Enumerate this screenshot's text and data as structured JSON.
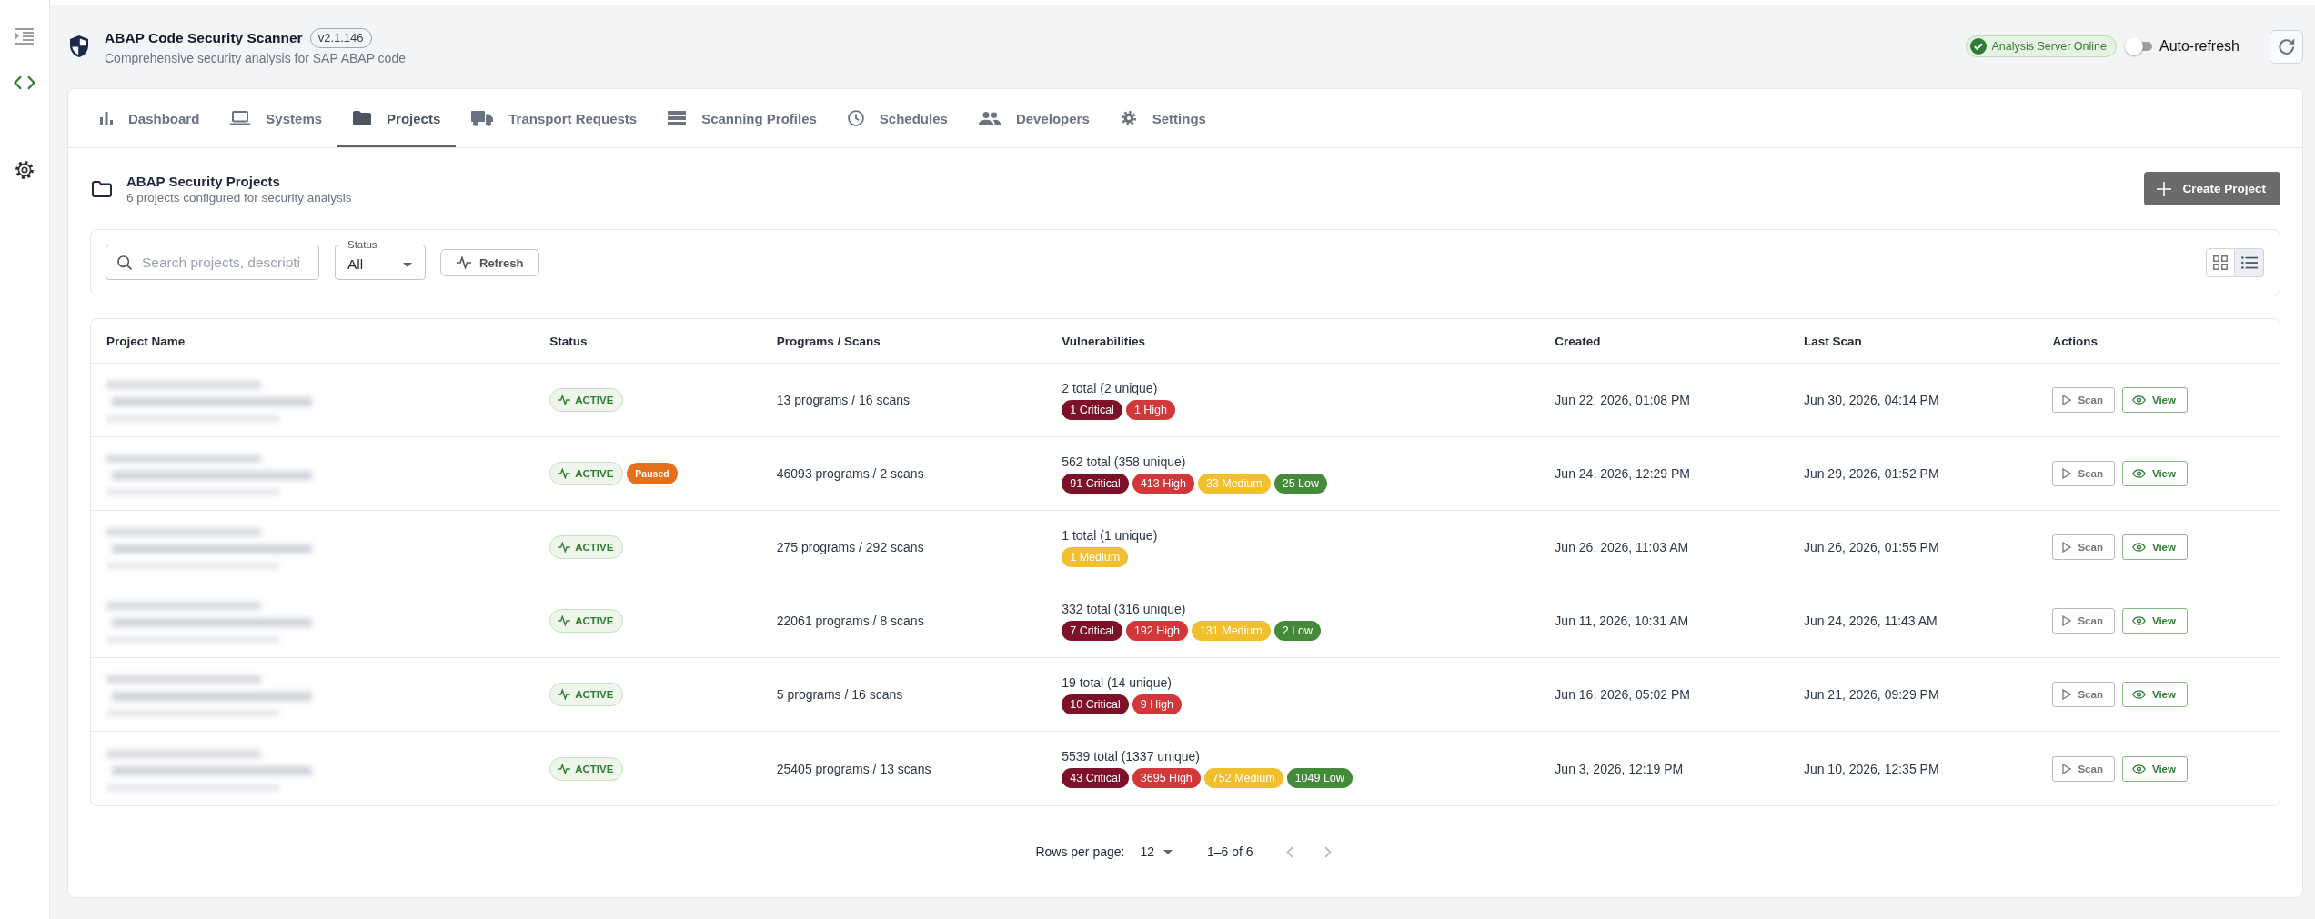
{
  "sidebar": {
    "items": [
      {
        "kind": "code",
        "selected": true
      },
      {
        "kind": "settings",
        "selected": false
      }
    ]
  },
  "header": {
    "title": "ABAP Code Security Scanner",
    "version": "v2.1.146",
    "subtitle": "Comprehensive security analysis for SAP ABAP code",
    "server_status": {
      "label": "Analysis Server Online",
      "online": true
    },
    "auto_refresh": {
      "label": "Auto-refresh",
      "on": false
    }
  },
  "tabs": [
    {
      "label": "Dashboard",
      "kind": "dashboard",
      "selected": false
    },
    {
      "label": "Systems",
      "kind": "systems",
      "selected": false
    },
    {
      "label": "Projects",
      "kind": "projects",
      "selected": true
    },
    {
      "label": "Transport Requests",
      "kind": "transport",
      "selected": false
    },
    {
      "label": "Scanning Profiles",
      "kind": "profiles",
      "selected": false
    },
    {
      "label": "Schedules",
      "kind": "schedules",
      "selected": false
    },
    {
      "label": "Developers",
      "kind": "developers",
      "selected": false
    },
    {
      "label": "Settings",
      "kind": "settings",
      "selected": false
    }
  ],
  "projects": {
    "title": "ABAP Security Projects",
    "subtitle": "6 projects configured for security analysis",
    "create_button": "Create Project",
    "filters": {
      "search": {
        "placeholder": "Search projects, descripti"
      },
      "status": {
        "label": "Status",
        "value": "All"
      },
      "refresh_button": "Refresh",
      "view_modes": [
        {
          "kind": "grid",
          "selected": false
        },
        {
          "kind": "list",
          "selected": true
        }
      ]
    },
    "table": {
      "columns": [
        "Project Name",
        "Status",
        "Programs / Scans",
        "Vulnerabilities",
        "Created",
        "Last Scan",
        "Actions"
      ],
      "rows": [
        {
          "status_badges": [
            {
              "label": "ACTIVE",
              "kind": "active"
            }
          ],
          "programs_scans": "13 programs / 16 scans",
          "vulnerabilities": {
            "summary": "2 total (2 unique)",
            "counts": [
              {
                "label": "1 Critical",
                "color": "#7d1128"
              },
              {
                "label": "1 High",
                "color": "#d0383a"
              }
            ]
          },
          "created": "Jun 22, 2026, 01:08 PM",
          "last_scan": "Jun 30, 2026, 04:14 PM",
          "actions": [
            {
              "label": "Scan",
              "kind": "scan"
            },
            {
              "label": "View",
              "kind": "view"
            }
          ]
        },
        {
          "status_badges": [
            {
              "label": "ACTIVE",
              "kind": "active"
            },
            {
              "label": "Paused",
              "kind": "paused"
            }
          ],
          "programs_scans": "46093 programs / 2 scans",
          "vulnerabilities": {
            "summary": "562 total (358 unique)",
            "counts": [
              {
                "label": "91 Critical",
                "color": "#7d1128"
              },
              {
                "label": "413 High",
                "color": "#d0383a"
              },
              {
                "label": "33 Medium",
                "color": "#f2bf2f"
              },
              {
                "label": "25 Low",
                "color": "#458a3b"
              }
            ]
          },
          "created": "Jun 24, 2026, 12:29 PM",
          "last_scan": "Jun 29, 2026, 01:52 PM",
          "actions": [
            {
              "label": "Scan",
              "kind": "scan"
            },
            {
              "label": "View",
              "kind": "view"
            }
          ]
        },
        {
          "status_badges": [
            {
              "label": "ACTIVE",
              "kind": "active"
            }
          ],
          "programs_scans": "275 programs / 292 scans",
          "vulnerabilities": {
            "summary": "1 total (1 unique)",
            "counts": [
              {
                "label": "1 Medium",
                "color": "#f2bf2f"
              }
            ]
          },
          "created": "Jun 26, 2026, 11:03 AM",
          "last_scan": "Jun 26, 2026, 01:55 PM",
          "actions": [
            {
              "label": "Scan",
              "kind": "scan"
            },
            {
              "label": "View",
              "kind": "view"
            }
          ]
        },
        {
          "status_badges": [
            {
              "label": "ACTIVE",
              "kind": "active"
            }
          ],
          "programs_scans": "22061 programs / 8 scans",
          "vulnerabilities": {
            "summary": "332 total (316 unique)",
            "counts": [
              {
                "label": "7 Critical",
                "color": "#7d1128"
              },
              {
                "label": "192 High",
                "color": "#d0383a"
              },
              {
                "label": "131 Medium",
                "color": "#f2bf2f"
              },
              {
                "label": "2 Low",
                "color": "#458a3b"
              }
            ]
          },
          "created": "Jun 11, 2026, 10:31 AM",
          "last_scan": "Jun 24, 2026, 11:43 AM",
          "actions": [
            {
              "label": "Scan",
              "kind": "scan"
            },
            {
              "label": "View",
              "kind": "view"
            }
          ]
        },
        {
          "status_badges": [
            {
              "label": "ACTIVE",
              "kind": "active"
            }
          ],
          "programs_scans": "5 programs / 16 scans",
          "vulnerabilities": {
            "summary": "19 total (14 unique)",
            "counts": [
              {
                "label": "10 Critical",
                "color": "#7d1128"
              },
              {
                "label": "9 High",
                "color": "#d0383a"
              }
            ]
          },
          "created": "Jun 16, 2026, 05:02 PM",
          "last_scan": "Jun 21, 2026, 09:29 PM",
          "actions": [
            {
              "label": "Scan",
              "kind": "scan"
            },
            {
              "label": "View",
              "kind": "view"
            }
          ]
        },
        {
          "status_badges": [
            {
              "label": "ACTIVE",
              "kind": "active"
            }
          ],
          "programs_scans": "25405 programs / 13 scans",
          "vulnerabilities": {
            "summary": "5539 total (1337 unique)",
            "counts": [
              {
                "label": "43 Critical",
                "color": "#7d1128"
              },
              {
                "label": "3695 High",
                "color": "#d0383a"
              },
              {
                "label": "752 Medium",
                "color": "#f2bf2f"
              },
              {
                "label": "1049 Low",
                "color": "#458a3b"
              }
            ]
          },
          "created": "Jun 3, 2026, 12:19 PM",
          "last_scan": "Jun 10, 2026, 12:35 PM",
          "actions": [
            {
              "label": "Scan",
              "kind": "scan"
            },
            {
              "label": "View",
              "kind": "view"
            }
          ]
        }
      ]
    },
    "pagination": {
      "rows_per_page_label": "Rows per page:",
      "rows_per_page": "12",
      "range": "1–6 of 6",
      "previous_disabled": true,
      "next_disabled": true
    }
  }
}
